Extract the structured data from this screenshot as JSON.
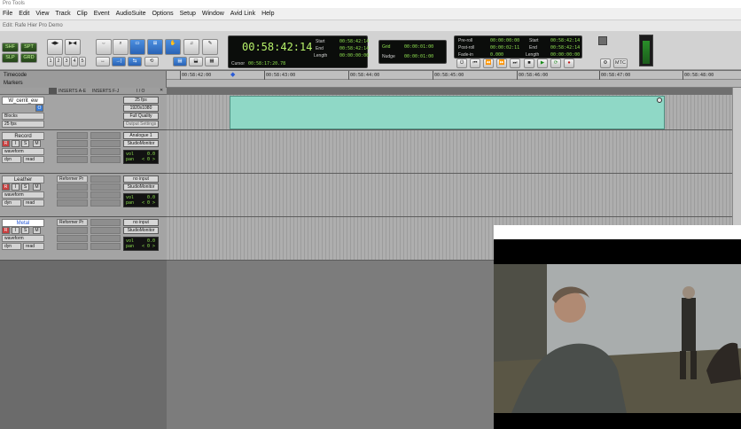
{
  "window": {
    "title": "Pro Tools",
    "subtitle": "Edit: Rafe Hier Pro Demo"
  },
  "menu": [
    "File",
    "Edit",
    "View",
    "Track",
    "Clip",
    "Event",
    "AudioSuite",
    "Options",
    "Setup",
    "Window",
    "Avid Link",
    "Help"
  ],
  "toolbar": {
    "main_counter": "00:58:42:14",
    "start_label": "Start",
    "start_val": "00:58:42:14",
    "end_label": "End",
    "end_val": "00:58:42:14",
    "length_label": "Length",
    "length_val": "00:00:00:00",
    "cursor_label": "Cursor",
    "cursor_val": "00:58:17:20.78",
    "nudge_label": "Nudge",
    "nudge_val": "00:00:01:00",
    "grid_label": "Grid",
    "grid_val": "00:00:01:00",
    "transport_start_label": "Start",
    "transport_start_val": "00:58:42:14",
    "transport_end_label": "End",
    "transport_end_val": "00:58:42:14",
    "transport_length_label": "Length",
    "transport_length_val": "00:00:00:00",
    "pre_roll_label": "Pre-roll",
    "pre_roll_val": "00:00:00:00",
    "post_roll_label": "Post-roll",
    "post_roll_val": "00:00:02:11",
    "fade_in_label": "Fade-in",
    "fade_in_val": "0.000",
    "mode_buttons": [
      "1",
      "2",
      "3",
      "4",
      "5"
    ],
    "mtc_label": "MTC"
  },
  "ruler": {
    "timecode_label": "Timecode",
    "markers_label": "Markers",
    "ticks": [
      "00:58:42:00",
      "00:58:43:00",
      "00:58:44:00",
      "00:58:45:00",
      "00:58:46:00",
      "00:58:47:00",
      "00:58:48:00"
    ]
  },
  "mix_columns": {
    "inserts_ae": "INSERTS A-E",
    "inserts_fj": "INSERTS F-J",
    "io": "I / O"
  },
  "tracks": [
    {
      "name": "W_cerrit_ew",
      "mode": "Blocks",
      "rate_small": "25 fps",
      "io": [
        "25 fps",
        "1920x1080",
        "Full Quality",
        "Output Settings"
      ]
    },
    {
      "name": "Record",
      "view": "waveform",
      "buttons": [
        "R",
        "S",
        "M"
      ],
      "auto": "read",
      "dyn": "dyn",
      "insert": "",
      "io": [
        "Analogue 1",
        "StudioMonitor"
      ],
      "vol_label": "vol",
      "vol_val": "0.0",
      "pan_label": "pan",
      "pan_val": "< 0 >"
    },
    {
      "name": "Leather",
      "view": "waveform",
      "buttons": [
        "R",
        "S",
        "M"
      ],
      "auto": "read",
      "dyn": "dyn",
      "insert": "Reformer Pr",
      "io": [
        "no input",
        "StudioMonitor"
      ],
      "vol_label": "vol",
      "vol_val": "0.0",
      "pan_label": "pan",
      "pan_val": "< 0 >"
    },
    {
      "name": "Metal",
      "view": "waveform",
      "buttons": [
        "R",
        "S",
        "M"
      ],
      "auto": "read",
      "dyn": "dyn",
      "insert": "Reformer Pr",
      "io": [
        "no input",
        "StudioMonitor"
      ],
      "vol_label": "vol",
      "vol_val": "0.0",
      "pan_label": "pan",
      "pan_val": "< 0 >"
    }
  ],
  "colors": {
    "clip": "#8fd8c6",
    "counter_text": "#b7f26a",
    "selected_tool": "#3a7bd5"
  }
}
